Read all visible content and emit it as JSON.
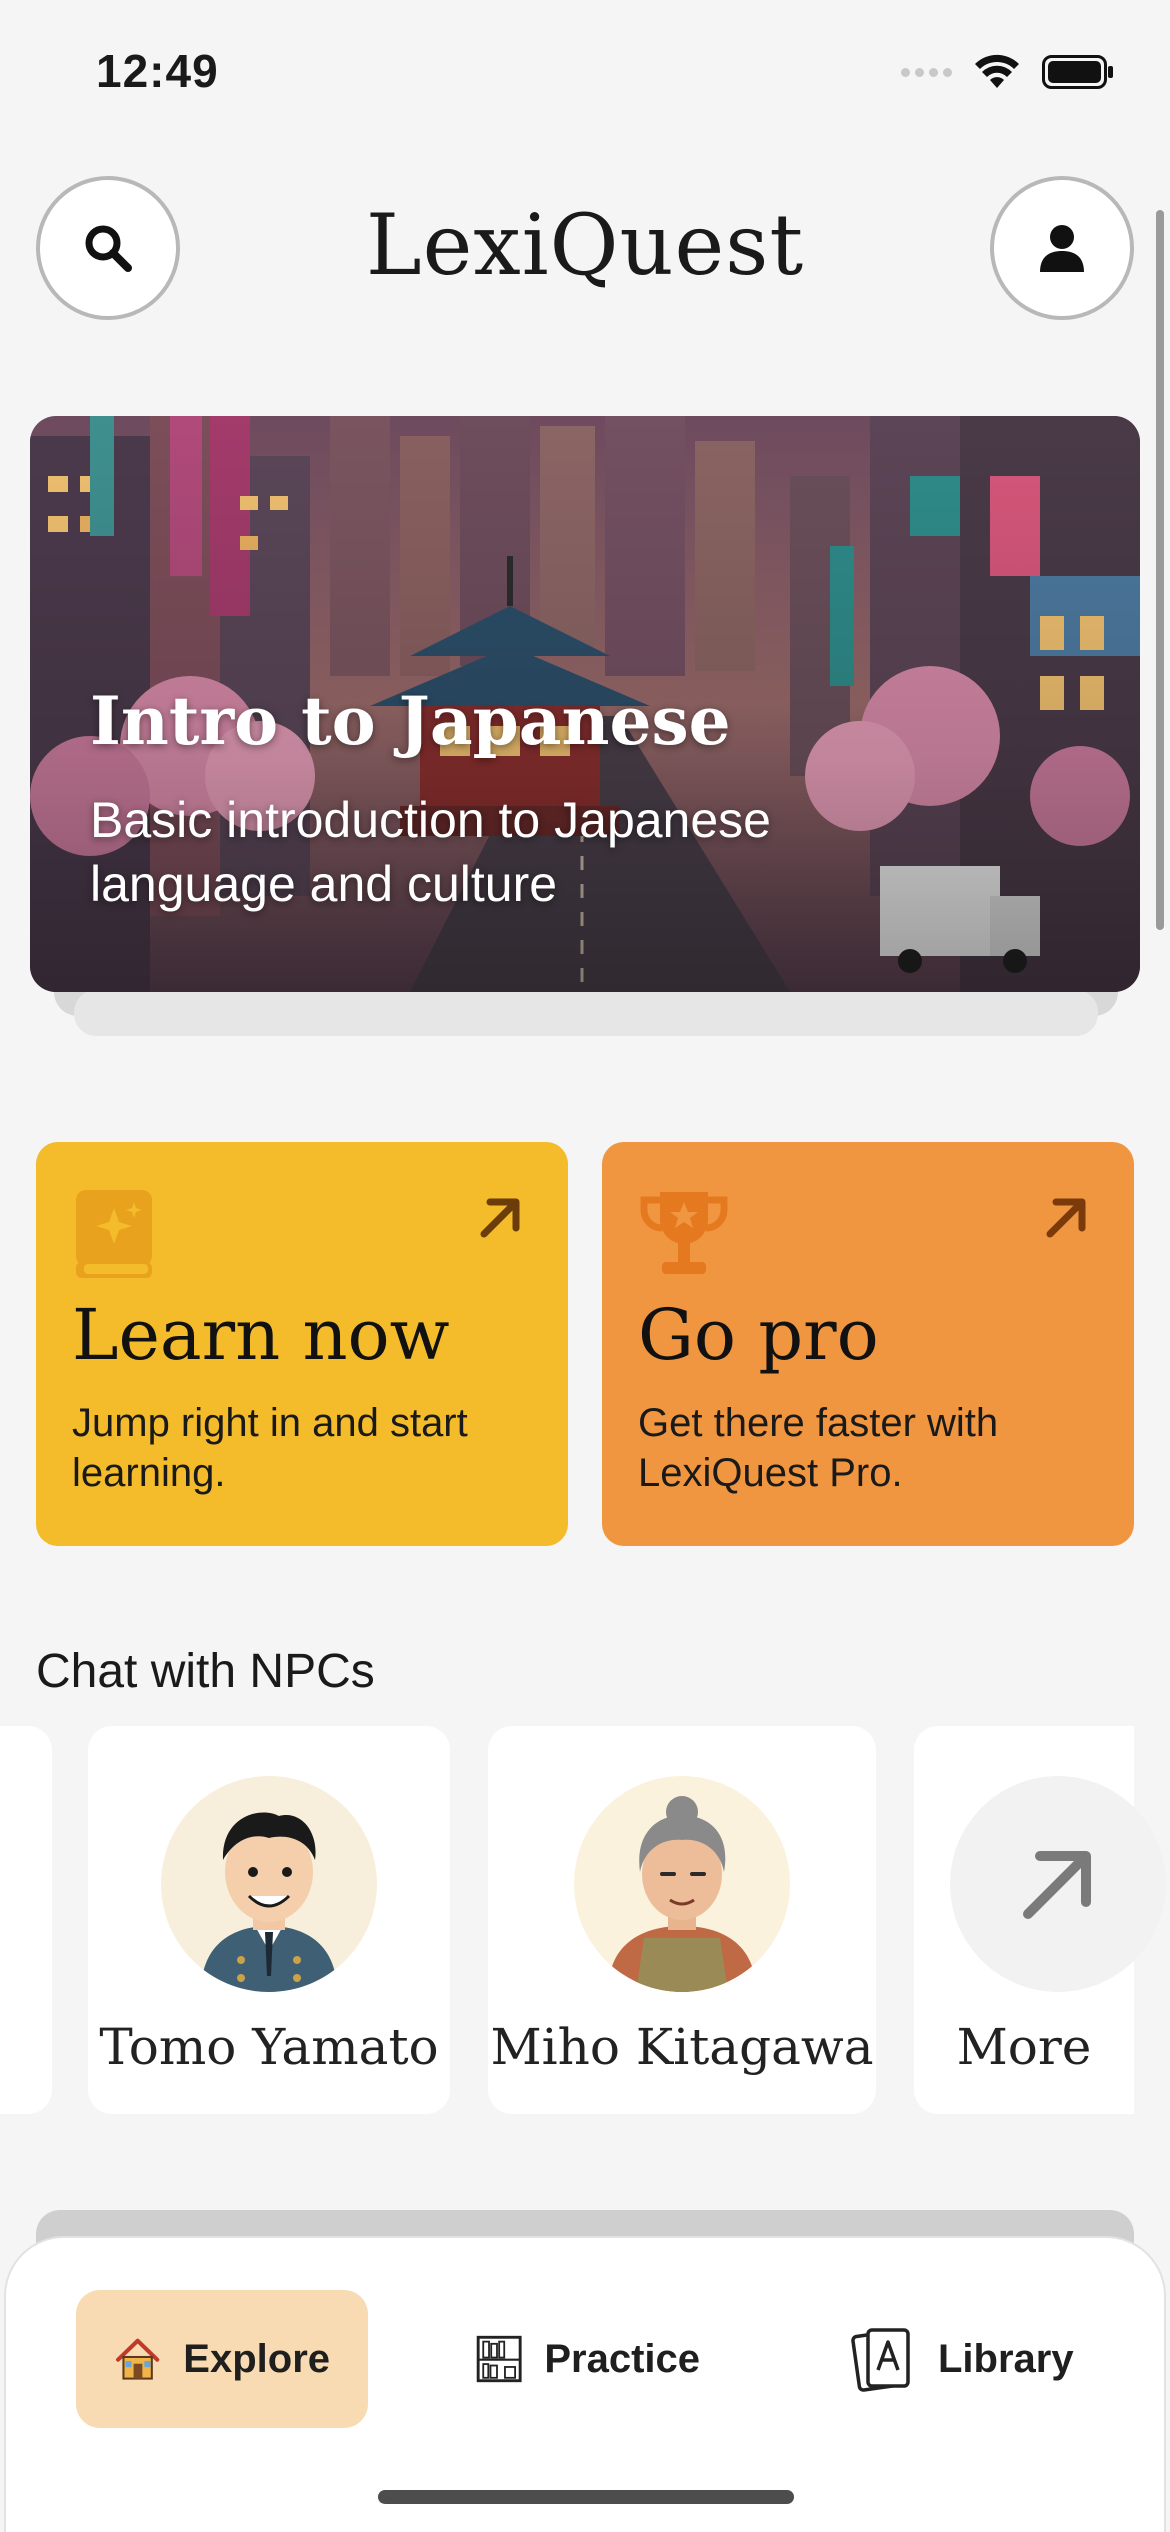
{
  "status_bar": {
    "time": "12:49"
  },
  "header": {
    "title": "LexiQuest",
    "search_icon": "search-icon",
    "profile_icon": "user-icon"
  },
  "hero": {
    "title": "Intro to Japanese",
    "subtitle": "Basic introduction to Japanese language and culture"
  },
  "cards": {
    "learn": {
      "title": "Learn now",
      "description": "Jump right in and start learning.",
      "icon": "book-sparkle-icon",
      "color": "#f4bb2a"
    },
    "pro": {
      "title": "Go pro",
      "description": "Get there faster with LexiQuest Pro.",
      "icon": "trophy-icon",
      "color": "#f19640"
    }
  },
  "npc_section": {
    "title": "Chat with NPCs",
    "npcs": [
      {
        "name": "Tomo Yamato"
      },
      {
        "name": "Miho Kitagawa"
      }
    ],
    "more_label": "More"
  },
  "tab_bar": {
    "tabs": [
      {
        "label": "Explore",
        "icon": "house-icon",
        "active": true
      },
      {
        "label": "Practice",
        "icon": "bookshelf-icon",
        "active": false
      },
      {
        "label": "Library",
        "icon": "cards-icon",
        "active": false
      }
    ],
    "active_color": "#f8dbb2"
  }
}
